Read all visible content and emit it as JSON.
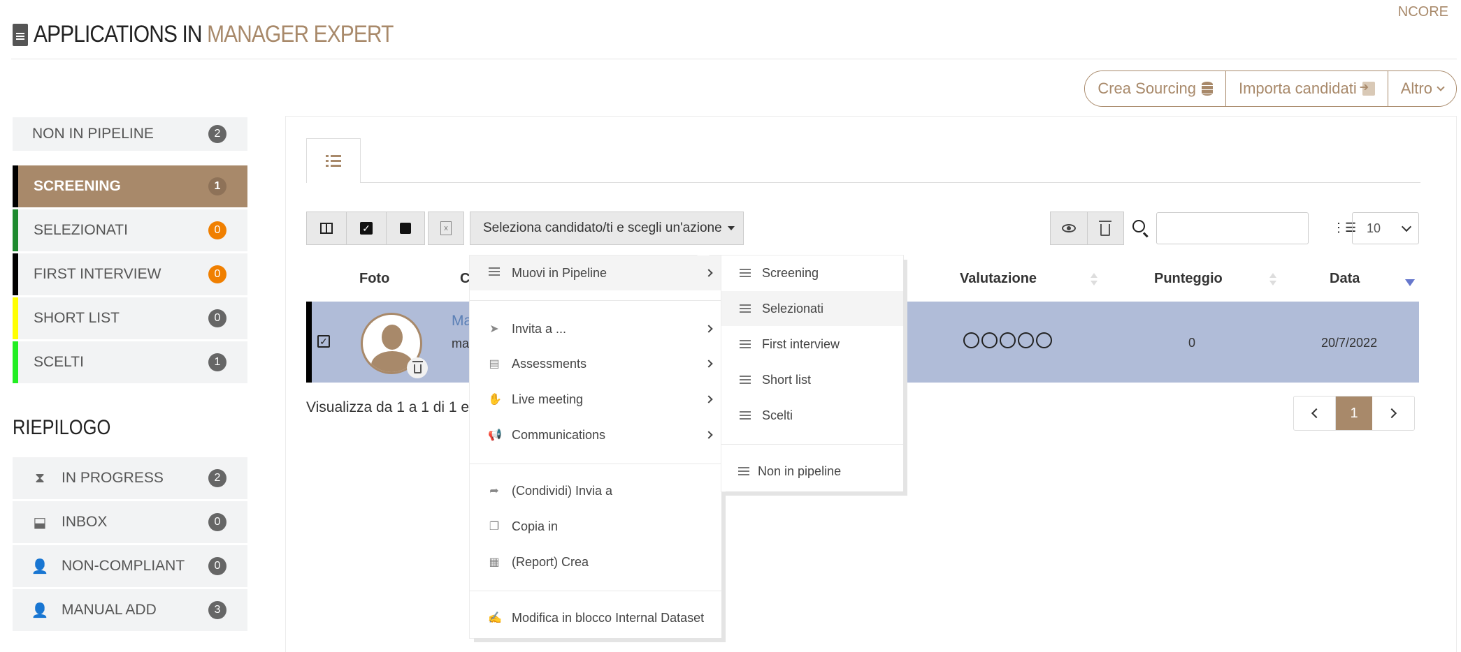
{
  "brand": "NCORE",
  "header": {
    "title_prefix": "APPLICATIONS IN",
    "title_accent": "MANAGER EXPERT"
  },
  "top_buttons": {
    "sourcing": "Crea Sourcing",
    "import": "Importa candidati",
    "more": "Altro"
  },
  "sidebar": {
    "non_pipeline": {
      "label": "NON IN PIPELINE",
      "count": "2"
    },
    "stages": [
      {
        "label": "SCREENING",
        "count": "1",
        "color": "#000000",
        "badge": "gray"
      },
      {
        "label": "SELEZIONATI",
        "count": "0",
        "color": "#1e8a2e",
        "badge": "orange"
      },
      {
        "label": "FIRST INTERVIEW",
        "count": "0",
        "color": "#000000",
        "badge": "orange"
      },
      {
        "label": "SHORT LIST",
        "count": "0",
        "color": "#ffff00",
        "badge": "gray"
      },
      {
        "label": "SCELTI",
        "count": "1",
        "color": "#22ee22",
        "badge": "gray"
      }
    ],
    "summary_title": "RIEPILOGO",
    "summary": [
      {
        "label": "IN PROGRESS",
        "count": "2",
        "icon": "hourglass-icon"
      },
      {
        "label": "INBOX",
        "count": "0",
        "icon": "inbox-icon"
      },
      {
        "label": "NON-COMPLIANT",
        "count": "0",
        "icon": "user-x-icon"
      },
      {
        "label": "MANUAL ADD",
        "count": "3",
        "icon": "user-plus-icon"
      }
    ]
  },
  "toolbar": {
    "action_dropdown": "Seleziona candidato/ti e scegli un'azione",
    "page_size": "10",
    "search_value": ""
  },
  "table": {
    "headers": {
      "foto": "Foto",
      "candidate_partial": "C",
      "valutazione": "Valutazione",
      "punteggio": "Punteggio",
      "data": "Data"
    },
    "row": {
      "name_partial": "Ma",
      "sub_partial": "ma",
      "punteggio": "0",
      "data": "20/7/2022"
    },
    "info": "Visualizza da 1 a 1 di 1 e",
    "page": "1"
  },
  "menu": {
    "items": [
      {
        "label": "Muovi in Pipeline",
        "icon": "list-icon"
      },
      {
        "label": "Invita a ...",
        "icon": "paper-plane-icon"
      },
      {
        "label": "Assessments",
        "icon": "clipboard-icon"
      },
      {
        "label": "Live meeting",
        "icon": "handshake-icon"
      },
      {
        "label": "Communications",
        "icon": "megaphone-icon"
      },
      {
        "label": "(Condividi) Invia a",
        "icon": "share-icon"
      },
      {
        "label": "Copia in",
        "icon": "copy-icon"
      },
      {
        "label": "(Report) Crea",
        "icon": "calculator-icon"
      },
      {
        "label": "Modifica in blocco Internal Dataset",
        "icon": "signature-icon"
      }
    ]
  },
  "submenu": {
    "items": [
      {
        "label": "Screening"
      },
      {
        "label": "Selezionati"
      },
      {
        "label": "First interview"
      },
      {
        "label": "Short list"
      },
      {
        "label": "Scelti"
      },
      {
        "label": "Non in pipeline"
      }
    ]
  }
}
